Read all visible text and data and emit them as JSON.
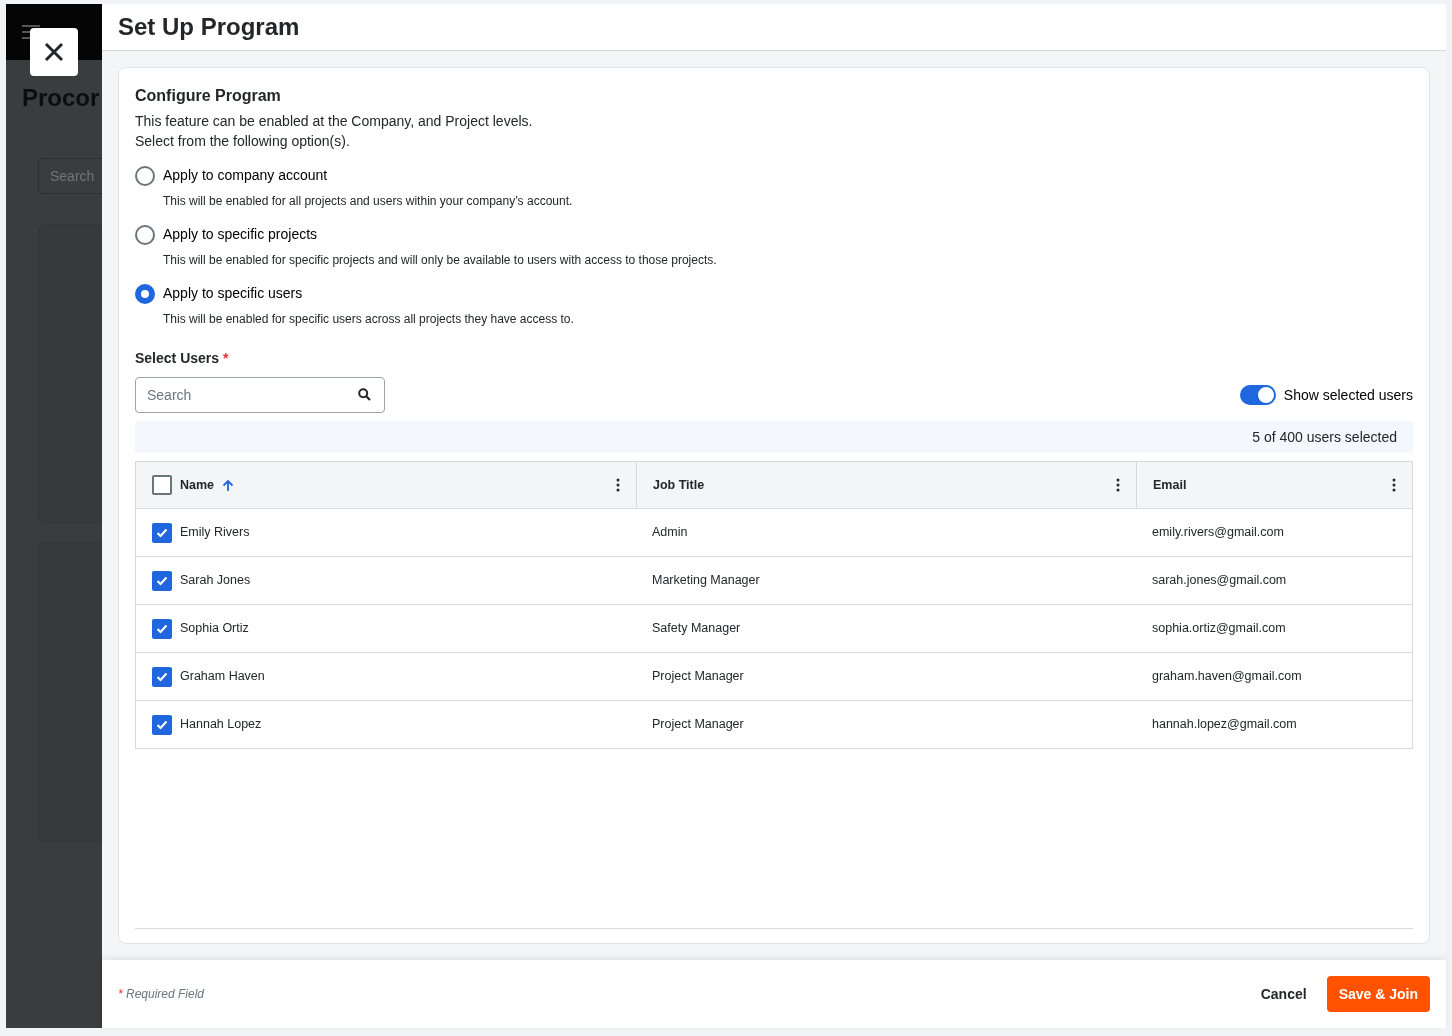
{
  "backdrop": {
    "title": "Procor",
    "search": {
      "placeholder": "Search"
    }
  },
  "drawer": {
    "title": "Set Up Program"
  },
  "section": {
    "heading": "Configure Program",
    "description": [
      "This feature can be enabled at the Company, and Project levels.",
      "Select from the following option(s)."
    ]
  },
  "options": [
    {
      "label": "Apply to company account",
      "hint": "This will be enabled for all projects and users within your company’s account.",
      "selected": false
    },
    {
      "label": "Apply to specific projects",
      "hint": "This will be enabled for specific projects and will only be available to users with access to those projects.",
      "selected": false
    },
    {
      "label": "Apply to specific users",
      "hint": "This will be enabled for specific users across all projects they have access to.",
      "selected": true
    }
  ],
  "select_users": {
    "label": "Select Users",
    "required_mark": "*",
    "search": {
      "placeholder": "Search"
    },
    "toggle": {
      "label": "Show selected users",
      "on": true
    },
    "selection_count": "5 of 400 users selected"
  },
  "table": {
    "select_all_checked": false,
    "columns": [
      {
        "label": "Name",
        "sorted_ascending": true
      },
      {
        "label": "Job Title"
      },
      {
        "label": "Email"
      }
    ],
    "rows": [
      {
        "checked": true,
        "cells": [
          "Emily Rivers",
          "Admin",
          "emily.rivers@gmail.com"
        ]
      },
      {
        "checked": true,
        "cells": [
          "Sarah Jones",
          "Marketing Manager",
          "sarah.jones@gmail.com"
        ]
      },
      {
        "checked": true,
        "cells": [
          "Sophia Ortiz",
          "Safety Manager",
          "sophia.ortiz@gmail.com"
        ]
      },
      {
        "checked": true,
        "cells": [
          "Graham Haven",
          "Project Manager",
          "graham.haven@gmail.com"
        ]
      },
      {
        "checked": true,
        "cells": [
          "Hannah Lopez",
          "Project Manager",
          "hannah.lopez@gmail.com"
        ]
      }
    ]
  },
  "footer": {
    "required_mark": "*",
    "required_note": "Required Field",
    "buttons": [
      {
        "label": "Cancel",
        "kind": "secondary"
      },
      {
        "label": "Save & Join",
        "kind": "primary"
      }
    ]
  }
}
